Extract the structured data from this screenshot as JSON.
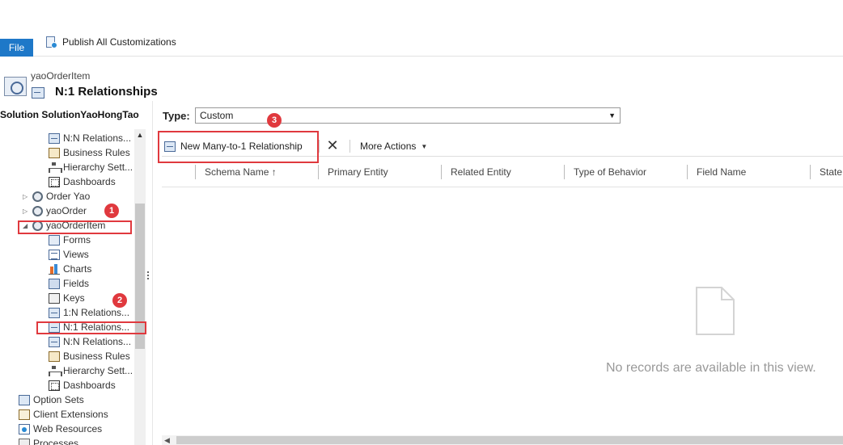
{
  "ribbon": {
    "file_label": "File",
    "publish_label": "Publish All Customizations"
  },
  "header": {
    "entity_name": "yaoOrderItem",
    "page_title": "N:1 Relationships",
    "solution_title": "Solution SolutionYaoHongTao"
  },
  "nav": {
    "items": [
      {
        "label": "N:N Relations...",
        "icon": "relationship-icon"
      },
      {
        "label": "Business Rules",
        "icon": "business-rules-icon"
      },
      {
        "label": "Hierarchy Sett...",
        "icon": "hierarchy-icon"
      },
      {
        "label": "Dashboards",
        "icon": "dashboard-icon"
      },
      {
        "label": "Order Yao",
        "icon": "entity-icon",
        "expander": "▷"
      },
      {
        "label": "yaoOrder",
        "icon": "entity-icon",
        "expander": "▷"
      },
      {
        "label": "yaoOrderItem",
        "icon": "entity-icon",
        "expander": "◢"
      },
      {
        "label": "Forms",
        "icon": "forms-icon"
      },
      {
        "label": "Views",
        "icon": "views-icon"
      },
      {
        "label": "Charts",
        "icon": "charts-icon"
      },
      {
        "label": "Fields",
        "icon": "fields-icon"
      },
      {
        "label": "Keys",
        "icon": "keys-icon"
      },
      {
        "label": "1:N Relations...",
        "icon": "relationship-icon"
      },
      {
        "label": "N:1 Relations...",
        "icon": "relationship-icon"
      },
      {
        "label": "N:N Relations...",
        "icon": "relationship-icon"
      },
      {
        "label": "Business Rules",
        "icon": "business-rules-icon"
      },
      {
        "label": "Hierarchy Sett...",
        "icon": "hierarchy-icon"
      },
      {
        "label": "Dashboards",
        "icon": "dashboard-icon"
      },
      {
        "label": "Option Sets",
        "icon": "option-sets-icon"
      },
      {
        "label": "Client Extensions",
        "icon": "client-extensions-icon"
      },
      {
        "label": "Web Resources",
        "icon": "web-resources-icon"
      },
      {
        "label": "Processes",
        "icon": "processes-icon"
      }
    ]
  },
  "filter": {
    "type_label": "Type:",
    "type_value": "Custom"
  },
  "toolbar": {
    "new_label": "New Many-to-1 Relationship",
    "delete_symbol": "✕",
    "more_actions_label": "More Actions"
  },
  "grid": {
    "columns": [
      "Schema Name ↑",
      "Primary Entity",
      "Related Entity",
      "Type of Behavior",
      "Field Name",
      "State"
    ],
    "empty_message": "No records are available in this view."
  },
  "annotations": [
    "1",
    "2",
    "3"
  ],
  "colors": {
    "file_tab": "#1e78c8",
    "annotation_red": "#e0393e"
  }
}
